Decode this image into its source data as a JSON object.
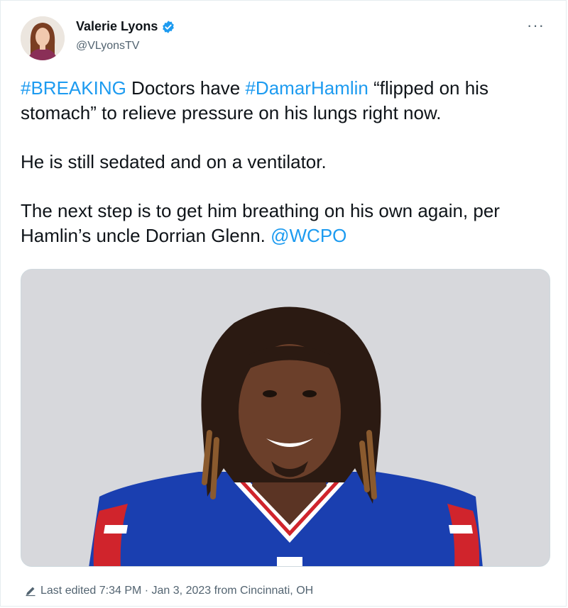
{
  "author": {
    "display_name": "Valerie Lyons",
    "handle": "@VLyonsTV",
    "verified_icon": "verified-badge-icon",
    "avatar_icon": "profile-photo"
  },
  "menu": {
    "more_label": "···"
  },
  "tweet": {
    "p1_tag1": "#BREAKING",
    "p1_text1": " Doctors have ",
    "p1_tag2": "#DamarHamlin",
    "p1_text2": " “flipped on his stomach” to relieve pressure on his lungs right now.",
    "p2": "He is still sedated and on a ventilator.",
    "p3_text": "The next step is to get him breathing on his own again, per Hamlin’s uncle Dorrian Glenn. ",
    "p3_mention": "@WCPO"
  },
  "footer": {
    "edited_label": "Last edited 7:34 PM · Jan 3, 2023 from Cincinnati, OH",
    "edit_icon": "pencil-icon"
  },
  "colors": {
    "link": "#1d9bf0",
    "secondary_text": "#536471",
    "verified": "#1d9bf0",
    "media_background": "#d7d8dc",
    "jersey_blue": "#1a3fb0",
    "jersey_red": "#d0242c"
  }
}
